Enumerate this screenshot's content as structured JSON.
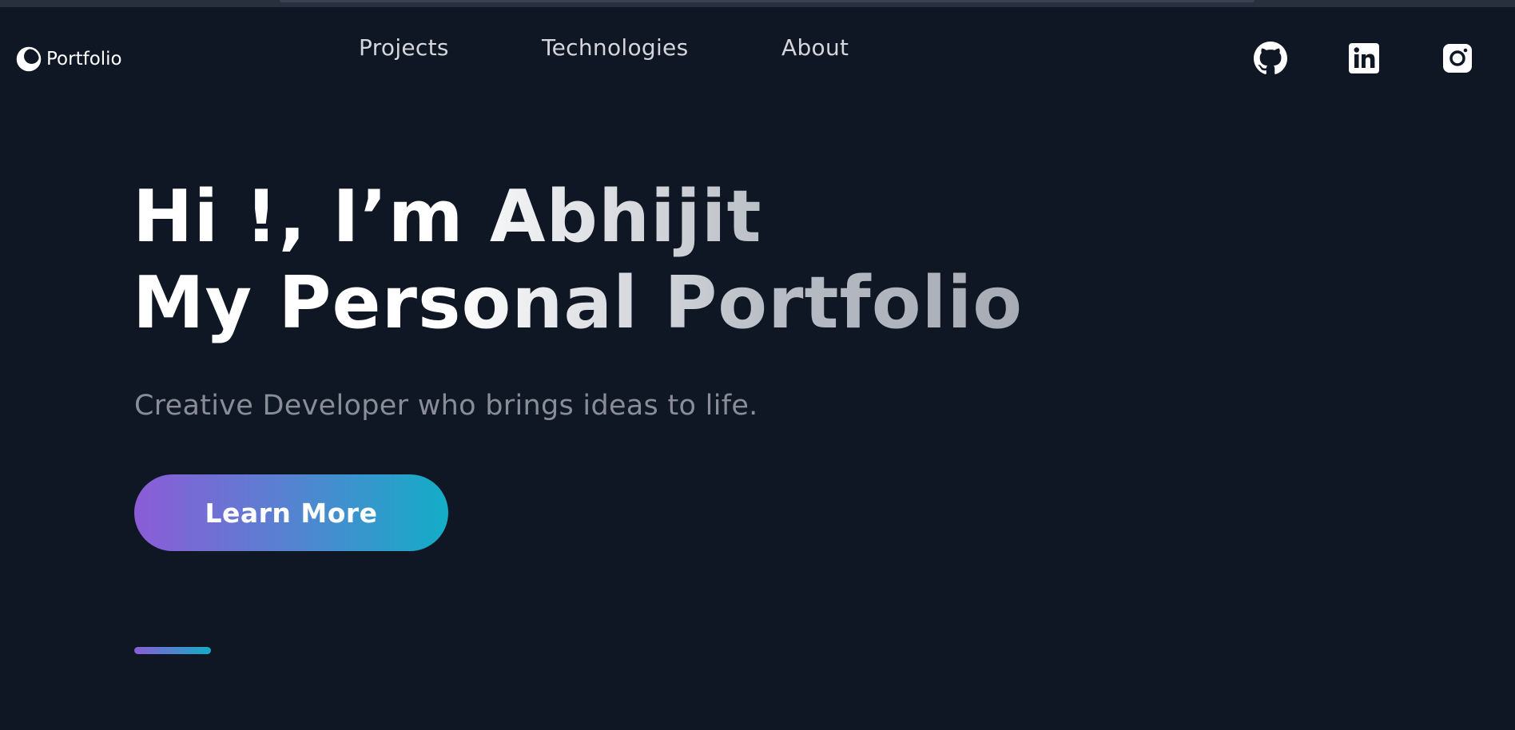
{
  "brand": {
    "name": "Portfolio",
    "icon": "crescent-circle-icon"
  },
  "nav": {
    "items": [
      {
        "label": "Projects"
      },
      {
        "label": "Technologies"
      },
      {
        "label": "About"
      }
    ]
  },
  "social": {
    "items": [
      {
        "icon": "github-icon"
      },
      {
        "icon": "linkedin-icon"
      },
      {
        "icon": "instagram-icon"
      }
    ]
  },
  "hero": {
    "title_line1": "Hi !, I’m Abhijit",
    "title_line2": "My Personal Portfolio",
    "subtitle": "Creative Developer who brings ideas to life.",
    "cta_label": "Learn More"
  },
  "colors": {
    "background": "#0f1624",
    "accent_start": "#8b5cd6",
    "accent_end": "#13adc7"
  }
}
